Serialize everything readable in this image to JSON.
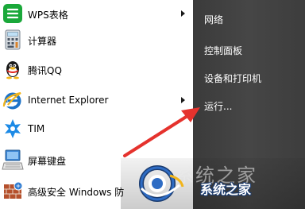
{
  "left_menu": {
    "programs": [
      {
        "label": "WPS表格",
        "icon": "wps-spreadsheet-icon",
        "submenu": true
      },
      {
        "label": "计算器",
        "icon": "calculator-icon",
        "submenu": false
      },
      {
        "label": "腾讯QQ",
        "icon": "qq-penguin-icon",
        "submenu": false
      },
      {
        "label": "Internet Explorer",
        "icon": "internet-explorer-icon",
        "submenu": true
      },
      {
        "label": "TIM",
        "icon": "tim-icon",
        "submenu": false
      },
      {
        "label": "屏幕键盘",
        "icon": "on-screen-keyboard-icon",
        "submenu": false
      },
      {
        "label": "高级安全 Windows 防",
        "icon": "firewall-icon",
        "submenu": false
      }
    ]
  },
  "right_menu": {
    "items": [
      {
        "label": "网络"
      },
      {
        "label": "控制面板"
      },
      {
        "label": "设备和打印机"
      },
      {
        "label": "运行..."
      }
    ]
  },
  "watermark": {
    "text": "系统之家",
    "background_text": "系统之家"
  },
  "colors": {
    "right_pane_bg": "#424242",
    "pointer_arrow": "#e5322d",
    "wps_green": "#1aa83a",
    "ie_blue": "#1e73c8",
    "tim_blue": "#1c8ae6",
    "watermark_blue": "#1b3c70"
  }
}
